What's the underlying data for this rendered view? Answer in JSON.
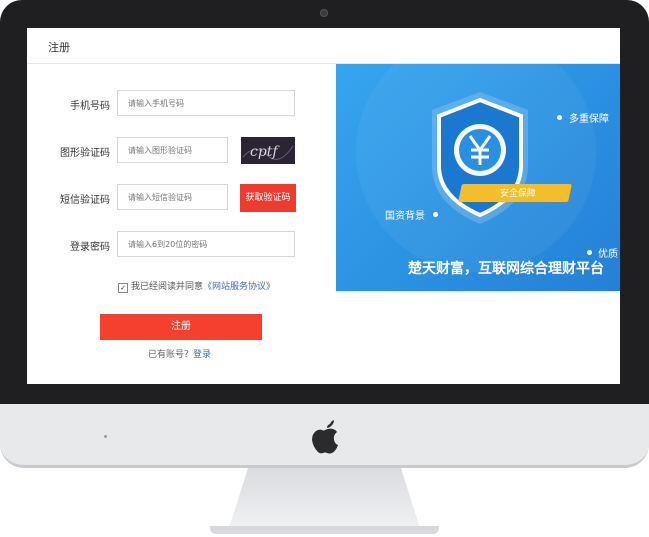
{
  "header": {
    "title": "注册"
  },
  "form": {
    "phone": {
      "label": "手机号码",
      "placeholder": "请输入手机号码"
    },
    "captcha": {
      "label": "图形验证码",
      "placeholder": "请输入图形验证码",
      "image_text": "cptf"
    },
    "sms": {
      "label": "短信验证码",
      "placeholder": "请输入短信验证码",
      "button": "获取验证码"
    },
    "password": {
      "label": "登录密码",
      "placeholder": "请输入6到20位的密码"
    },
    "agree_text": "我已经阅读并同意",
    "agree_link": "《网站服务协议》",
    "submit": "注册",
    "login_prompt": "已有账号？",
    "login_link": "登录"
  },
  "banner": {
    "label_top": "多重保障",
    "label_left": "国资背景",
    "label_right": "优质",
    "ribbon": "安全保障",
    "slogan": "楚天财富，互联网综合理财平台"
  },
  "colors": {
    "accent_red": "#ee3b2f",
    "link_blue": "#3b6fb6",
    "banner_blue": "#2a8fe0"
  },
  "icons": {
    "device_logo": "apple-logo-icon",
    "shield": "shield-yuan-icon"
  }
}
